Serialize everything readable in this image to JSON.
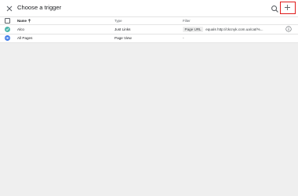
{
  "header": {
    "title": "Choose a trigger"
  },
  "table": {
    "columns": {
      "name": "Name",
      "type": "Type",
      "filter": "Filter"
    },
    "rows": [
      {
        "name": "Alco",
        "type": "Just Links",
        "filter_chip": "Page URL",
        "filter_text": "equals http://ckcnyk.com.ua/cat/%...",
        "icon_color": "#4db6ac"
      },
      {
        "name": "All Pages",
        "type": "Page View",
        "filter_text": "-",
        "icon_color": "#3b78e7"
      }
    ]
  },
  "colors": {
    "highlight": "#e01b1b",
    "background": "#efefef"
  }
}
